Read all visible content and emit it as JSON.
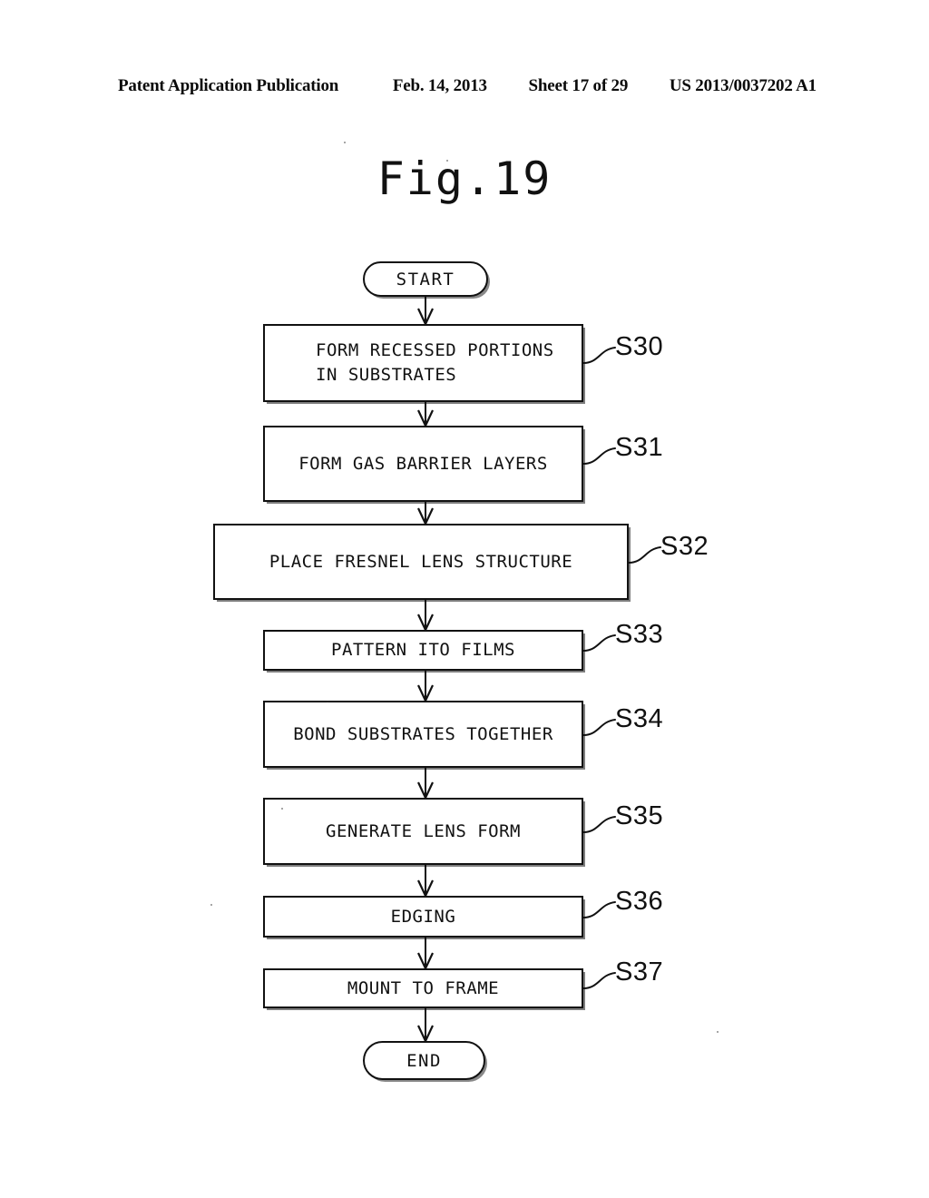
{
  "header": {
    "publication": "Patent Application Publication",
    "date": "Feb. 14, 2013",
    "sheet": "Sheet 17 of 29",
    "doc_number": "US 2013/0037202 A1"
  },
  "figure": {
    "title": "Fig.19"
  },
  "chart_data": {
    "type": "flowchart",
    "title": "Fig.19",
    "orientation": "top-to-bottom",
    "nodes": [
      {
        "id": "start",
        "shape": "terminator",
        "text": "START",
        "step": ""
      },
      {
        "id": "s30",
        "shape": "process",
        "text": "FORM RECESSED PORTIONS\nIN SUBSTRATES",
        "step": "S30"
      },
      {
        "id": "s31",
        "shape": "process",
        "text": "FORM GAS BARRIER LAYERS",
        "step": "S31"
      },
      {
        "id": "s32",
        "shape": "process",
        "text": "PLACE FRESNEL LENS STRUCTURE",
        "step": "S32"
      },
      {
        "id": "s33",
        "shape": "process",
        "text": "PATTERN ITO FILMS",
        "step": "S33"
      },
      {
        "id": "s34",
        "shape": "process",
        "text": "BOND SUBSTRATES TOGETHER",
        "step": "S34"
      },
      {
        "id": "s35",
        "shape": "process",
        "text": "GENERATE LENS FORM",
        "step": "S35"
      },
      {
        "id": "s36",
        "shape": "process",
        "text": "EDGING",
        "step": "S36"
      },
      {
        "id": "s37",
        "shape": "process",
        "text": "MOUNT TO FRAME",
        "step": "S37"
      },
      {
        "id": "end",
        "shape": "terminator",
        "text": "END",
        "step": ""
      }
    ],
    "edges": [
      {
        "from": "start",
        "to": "s30"
      },
      {
        "from": "s30",
        "to": "s31"
      },
      {
        "from": "s31",
        "to": "s32"
      },
      {
        "from": "s32",
        "to": "s33"
      },
      {
        "from": "s33",
        "to": "s34"
      },
      {
        "from": "s34",
        "to": "s35"
      },
      {
        "from": "s35",
        "to": "s36"
      },
      {
        "from": "s36",
        "to": "s37"
      },
      {
        "from": "s37",
        "to": "end"
      }
    ],
    "colors": {
      "line": "#111111",
      "background": "#ffffff"
    }
  }
}
